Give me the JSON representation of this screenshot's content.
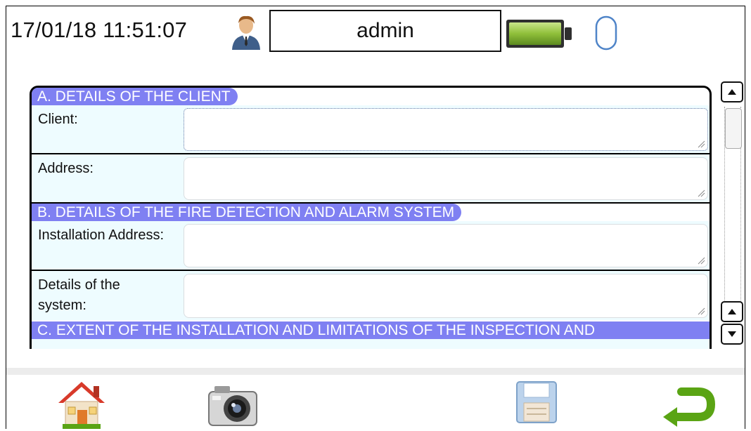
{
  "status": {
    "datetime": "17/01/18 11:51:07",
    "user": "admin",
    "icons": [
      "user-icon",
      "battery-icon",
      "mouse-icon"
    ]
  },
  "form": {
    "sections": [
      {
        "title": "A. DETAILS OF THE CLIENT",
        "fields": [
          {
            "label": "Client:",
            "value": ""
          },
          {
            "label": "Address:",
            "value": ""
          }
        ]
      },
      {
        "title": "B. DETAILS OF THE FIRE DETECTION AND ALARM SYSTEM",
        "fields": [
          {
            "label": "Installation Address:",
            "value": ""
          },
          {
            "label": "Details of the system:",
            "value": ""
          }
        ]
      },
      {
        "title": "C. EXTENT OF THE INSTALLATION AND LIMITATIONS OF THE INSPECTION AND",
        "fields": []
      }
    ]
  },
  "toolbar": {
    "icons": [
      "home-icon",
      "camera-icon",
      "save-icon",
      "return-icon"
    ]
  },
  "colors": {
    "section_header": "#7f80f2",
    "row_background": "#eefcff",
    "battery": "#8fbf3a",
    "return_arrow": "#5aa414"
  }
}
